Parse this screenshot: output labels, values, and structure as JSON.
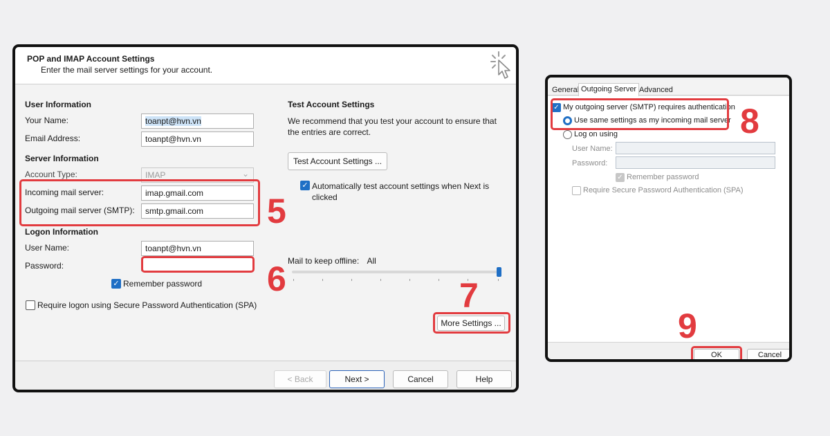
{
  "pop_dialog": {
    "title": "POP and IMAP Account Settings",
    "subtitle": "Enter the mail server settings for your account.",
    "user_info": {
      "heading": "User Information",
      "your_name_label": "Your Name:",
      "your_name_value": "toanpt@hvn.vn",
      "email_label": "Email Address:",
      "email_value": "toanpt@hvn.vn"
    },
    "server_info": {
      "heading": "Server Information",
      "account_type_label": "Account Type:",
      "account_type_value": "IMAP",
      "incoming_label": "Incoming mail server:",
      "incoming_value": "imap.gmail.com",
      "outgoing_label": "Outgoing mail server (SMTP):",
      "outgoing_value": "smtp.gmail.com"
    },
    "logon_info": {
      "heading": "Logon Information",
      "username_label": "User Name:",
      "username_value": "toanpt@hvn.vn",
      "password_label": "Password:",
      "password_value": "",
      "remember_label": "Remember password",
      "spa_label": "Require logon using Secure Password Authentication (SPA)"
    },
    "test": {
      "heading": "Test Account Settings",
      "description": "We recommend that you test your account to ensure that the entries are correct.",
      "button": "Test Account Settings ...",
      "auto_test_label": "Automatically test account settings when Next is clicked"
    },
    "offline": {
      "label": "Mail to keep offline:",
      "value": "All"
    },
    "more_settings": "More Settings ...",
    "footer": {
      "back": "< Back",
      "next": "Next >",
      "cancel": "Cancel",
      "help": "Help"
    }
  },
  "inet_dialog": {
    "tabs": [
      "General",
      "Outgoing Server",
      "Advanced"
    ],
    "requires_auth_label": "My outgoing server (SMTP) requires authentication",
    "use_same_label": "Use same settings as my incoming mail server",
    "log_on_using_label": "Log on using",
    "username_label": "User Name:",
    "password_label": "Password:",
    "remember_label": "Remember password",
    "spa_label": "Require Secure Password Authentication (SPA)",
    "ok": "OK",
    "cancel": "Cancel"
  },
  "steps": [
    "5",
    "6",
    "7",
    "8",
    "9"
  ],
  "colors": {
    "highlight": "#e23b3f",
    "accent": "#1f6fc5"
  },
  "icons": {
    "checkmark": "✓",
    "combo_arrow": "⌄"
  }
}
